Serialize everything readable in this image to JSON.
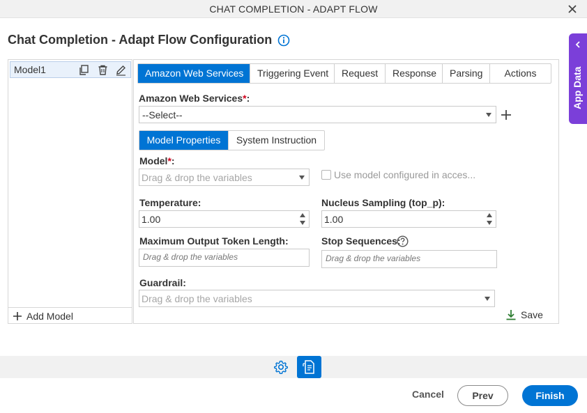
{
  "window": {
    "title": "CHAT COMPLETION - ADAPT FLOW"
  },
  "page": {
    "heading": "Chat Completion - Adapt Flow Configuration"
  },
  "app_data": {
    "label": "App Data"
  },
  "models": {
    "items": [
      {
        "label": "Model1"
      }
    ],
    "add_label": "Add Model"
  },
  "tabs": [
    {
      "label": "Amazon Web Services",
      "active": true
    },
    {
      "label": "Triggering Event"
    },
    {
      "label": "Request"
    },
    {
      "label": "Response"
    },
    {
      "label": "Parsing"
    },
    {
      "label": "Actions"
    }
  ],
  "aws": {
    "label": "Amazon Web Services",
    "required_mark": "*",
    "colon": ":",
    "selected": "--Select--"
  },
  "subtabs": [
    {
      "label": "Model Properties",
      "active": true
    },
    {
      "label": "System Instruction"
    }
  ],
  "form": {
    "model": {
      "label": "Model",
      "required_mark": "*",
      "colon": ":",
      "placeholder": "Drag & drop the variables"
    },
    "use_model_checkbox": {
      "label": "Use model configured in acces..."
    },
    "temperature": {
      "label": "Temperature:",
      "value": "1.00"
    },
    "top_p": {
      "label": "Nucleus Sampling (top_p):",
      "value": "1.00"
    },
    "max_tokens": {
      "label": "Maximum Output Token Length:",
      "placeholder": "Drag & drop the variables"
    },
    "stop_sequences": {
      "label": "Stop Sequences:",
      "placeholder": "Drag & drop the variables"
    },
    "guardrail": {
      "label": "Guardrail:",
      "placeholder": "Drag & drop the variables"
    }
  },
  "save_label": "Save",
  "footer": {
    "cancel_label": "Cancel",
    "prev_label": "Prev",
    "finish_label": "Finish"
  },
  "colors": {
    "accent": "#0074d4",
    "app_data": "#7b3fd9",
    "required": "#d0021b",
    "save_icon": "#2e7d32"
  }
}
